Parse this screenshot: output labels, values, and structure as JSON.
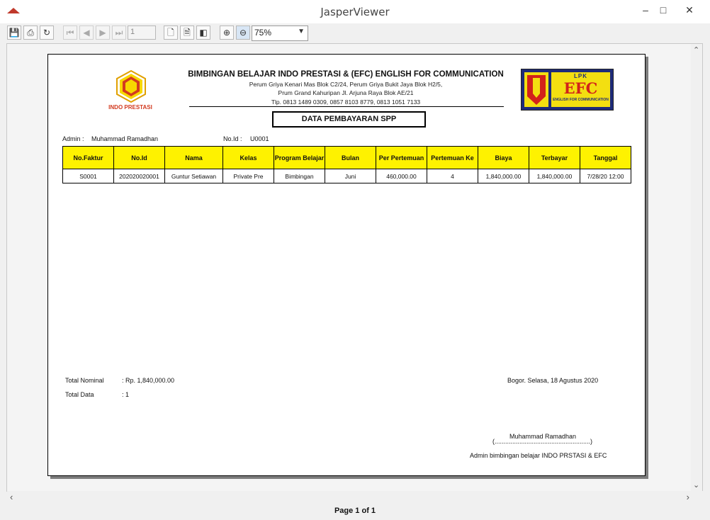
{
  "window": {
    "title": "JasperViewer",
    "minimize_icon": "minimize-icon",
    "maximize_icon": "maximize-icon",
    "close_icon": "close-icon"
  },
  "toolbar": {
    "page_number": "1",
    "zoom_value": "75%"
  },
  "status": {
    "page_info": "Page 1 of 1"
  },
  "report": {
    "header": {
      "logo_left_text": "INDO PRESTASI",
      "title": "BIMBINGAN BELAJAR INDO PRESTASI & (EFC) ENGLISH FOR COMMUNICATION",
      "address1": "Perum Griya Kenari Mas Blok C2/24, Perum Griya Bukit Jaya Blok H2/5,",
      "address2": "Prum Grand Kahuripan Jl. Arjuna Raya Blok AE/21",
      "phone": "Tlp. 0813 1489 0309, 0857 8103 8779, 0813 1051 7133",
      "logo_right_top": "LPK",
      "logo_right_main": "EFC",
      "logo_right_sub": "ENGLISH FOR COMMUNICATION"
    },
    "doc_title": "DATA PEMBAYARAN SPP",
    "admin_label": "Admin :",
    "admin_value": "Muhammad Ramadhan",
    "noid_label": "No.Id :",
    "noid_value": "U0001",
    "table": {
      "headers": [
        "No.Faktur",
        "No.Id",
        "Nama",
        "Kelas",
        "Program Belajar",
        "Bulan",
        "Per Pertemuan",
        "Pertemuan Ke",
        "Biaya",
        "Terbayar",
        "Tanggal"
      ],
      "rows": [
        [
          "S0001",
          "202020020001",
          "Guntur Setiawan",
          "Private Pre",
          "Bimbingan",
          "Juni",
          "460,000.00",
          "4",
          "1,840,000.00",
          "1,840,000.00",
          "7/28/20 12:00"
        ]
      ]
    },
    "footer": {
      "total_nominal_label": "Total Nominal",
      "total_nominal_value": ": Rp. 1,840,000.00",
      "total_data_label": "Total Data",
      "total_data_value": ": 1",
      "place_date": "Bogor. Selasa, 18 Agustus 2020",
      "signer": "Muhammad Ramadhan",
      "signature_line": "(......................................................)",
      "signer_title": "Admin bimbingan belajar INDO PRSTASI & EFC"
    }
  }
}
